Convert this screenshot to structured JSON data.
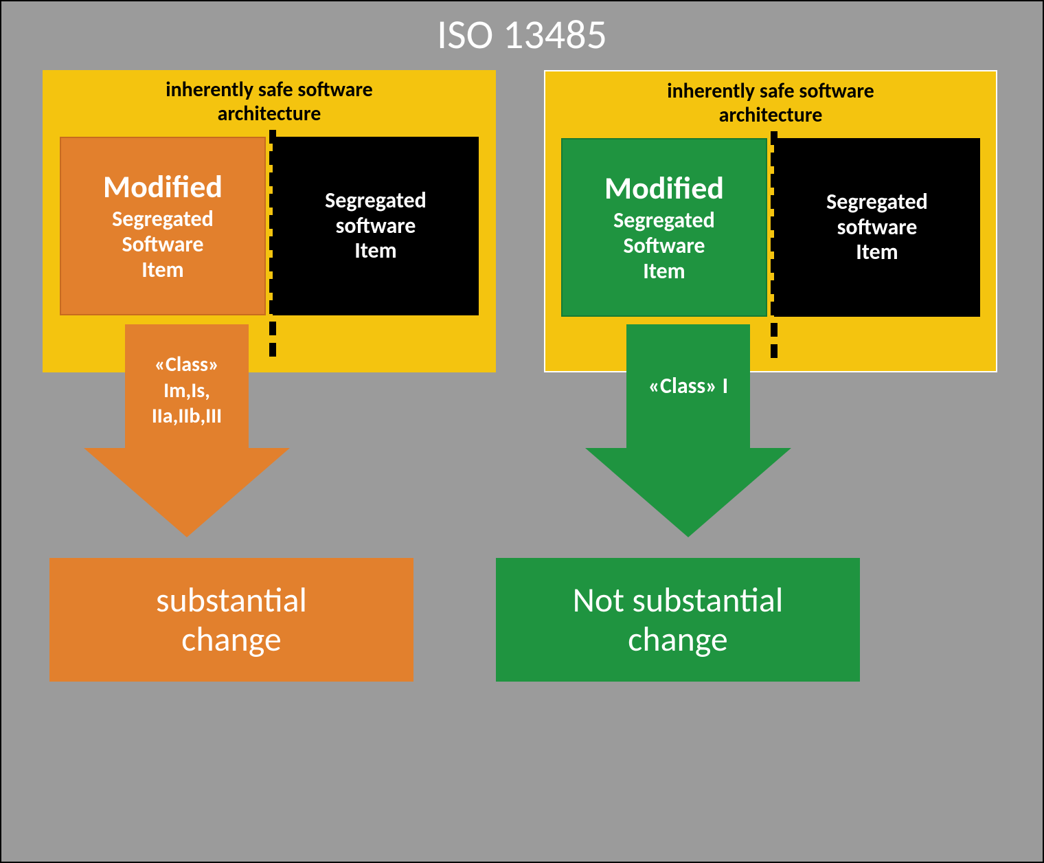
{
  "title": "ISO 13485",
  "left": {
    "arch_label_l1": "inherently safe software",
    "arch_label_l2": "architecture",
    "modified_big": "Modified",
    "modified_rest_l1": "Segregated",
    "modified_rest_l2": "Software",
    "modified_rest_l3": "Item",
    "segregated_l1": "Segregated",
    "segregated_l2": "software",
    "segregated_l3": "Item",
    "arrow_l1": "«Class»",
    "arrow_l2": "Im,Is,",
    "arrow_l3": "IIa,IIb,III",
    "result_l1": "substantial",
    "result_l2": "change",
    "color": "#e2802d"
  },
  "right": {
    "arch_label_l1": "inherently safe software",
    "arch_label_l2": "architecture",
    "modified_big": "Modified",
    "modified_rest_l1": "Segregated",
    "modified_rest_l2": "Software",
    "modified_rest_l3": "Item",
    "segregated_l1": "Segregated",
    "segregated_l2": "software",
    "segregated_l3": "Item",
    "arrow_l1": "«Class» I",
    "result_l1": "Not substantial",
    "result_l2": "change",
    "color": "#1f9440"
  }
}
